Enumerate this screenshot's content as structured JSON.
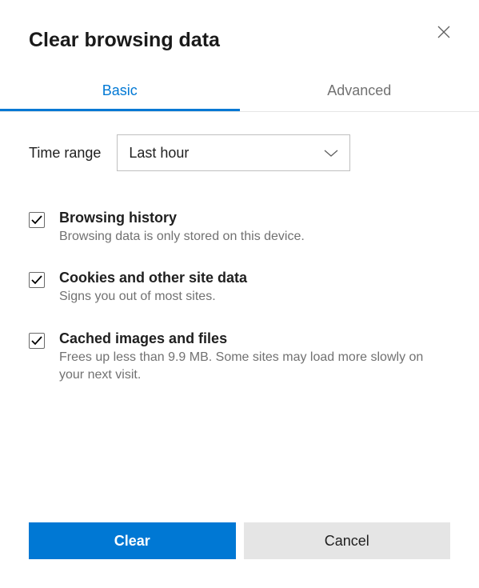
{
  "dialog": {
    "title": "Clear browsing data"
  },
  "tabs": {
    "basic": "Basic",
    "advanced": "Advanced"
  },
  "timeRange": {
    "label": "Time range",
    "selected": "Last hour"
  },
  "options": [
    {
      "title": "Browsing history",
      "description": "Browsing data is only stored on this device."
    },
    {
      "title": "Cookies and other site data",
      "description": "Signs you out of most sites."
    },
    {
      "title": "Cached images and files",
      "description": "Frees up less than 9.9 MB. Some sites may load more slowly on your next visit."
    }
  ],
  "buttons": {
    "clear": "Clear",
    "cancel": "Cancel"
  }
}
